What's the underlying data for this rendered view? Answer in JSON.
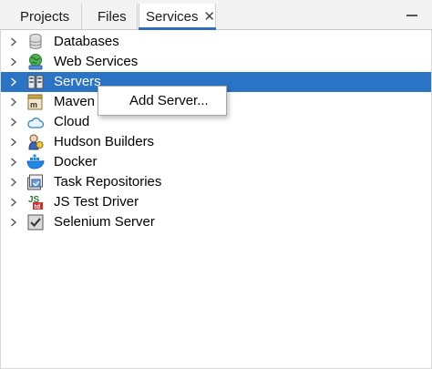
{
  "tabs": [
    {
      "label": "Projects"
    },
    {
      "label": "Files"
    },
    {
      "label": "Services",
      "close": "✕"
    }
  ],
  "tree": [
    {
      "label": "Databases",
      "icon": "database-icon"
    },
    {
      "label": "Web Services",
      "icon": "web-services-icon"
    },
    {
      "label": "Servers",
      "icon": "servers-icon",
      "selected": true
    },
    {
      "label": "Maven",
      "icon": "maven-icon"
    },
    {
      "label": "Cloud",
      "icon": "cloud-icon"
    },
    {
      "label": "Hudson Builders",
      "icon": "hudson-icon"
    },
    {
      "label": "Docker",
      "icon": "docker-icon"
    },
    {
      "label": "Task Repositories",
      "icon": "task-repositories-icon"
    },
    {
      "label": "JS Test Driver",
      "icon": "js-test-driver-icon"
    },
    {
      "label": "Selenium Server",
      "icon": "selenium-icon"
    }
  ],
  "context_menu": {
    "items": [
      {
        "label": "Add Server..."
      }
    ]
  },
  "colors": {
    "selection": "#2b73c4",
    "tab_accent": "#2f6fbd"
  }
}
